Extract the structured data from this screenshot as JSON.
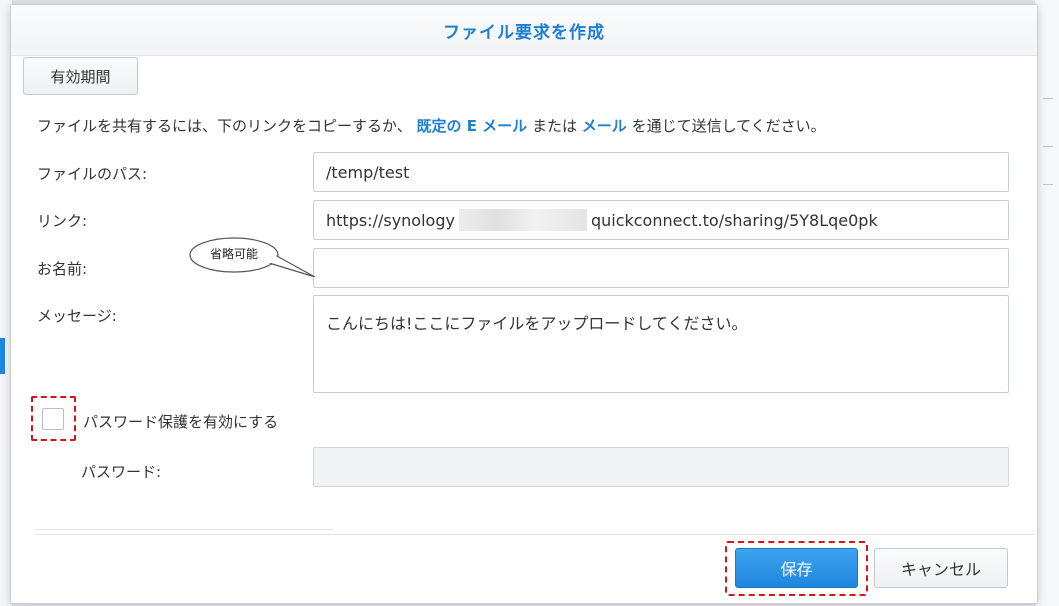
{
  "dialog": {
    "title": "ファイル要求を作成",
    "tab_label": "有効期間",
    "description": {
      "part1": "ファイルを共有するには、下のリンクをコピーするか、",
      "link1": "既定の E メール",
      "part2": "または",
      "link2": "メール",
      "part3": "を通じて送信してください。"
    },
    "fields": {
      "path_label": "ファイルのパス:",
      "path_value": "/temp/test",
      "link_label": "リンク:",
      "link_prefix": "https://synology",
      "link_suffix": "quickconnect.to/sharing/5Y8Lqe0pk",
      "name_label": "お名前:",
      "name_value": "",
      "message_label": "メッセージ:",
      "message_value": "こんにちは!ここにファイルをアップロードしてください。",
      "password_label": "パスワード:",
      "password_value": ""
    },
    "callout": "省略可能",
    "password_protect_label": "パスワード保護を有効にする",
    "password_protect_checked": false,
    "buttons": {
      "save": "保存",
      "cancel": "キャンセル"
    },
    "colors": {
      "accent": "#1e7fd0",
      "primary_button": "#2b93e6",
      "highlight_dash": "#d6141b"
    }
  }
}
